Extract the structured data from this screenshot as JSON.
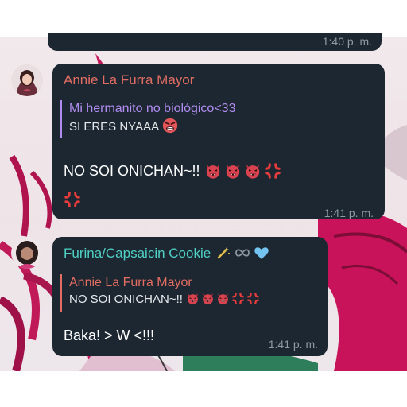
{
  "messages": [
    {
      "time": "1:40 p. m."
    },
    {
      "sender": "Annie La Furra Mayor",
      "sender_color": "#e36d62",
      "reply": {
        "sender": "Mi hermanito no biológico<33",
        "sender_color": "#b18cf0",
        "text": "SI ERES NYAAA"
      },
      "text": "NO SOI ONICHAN~!!",
      "time": "1:41 p. m."
    },
    {
      "sender": "Furina/Capsaicin Cookie",
      "sender_color": "#4fd1c5",
      "reply": {
        "sender": "Annie La Furra Mayor",
        "sender_color": "#e36d62",
        "text": "NO SOI ONICHAN~!!"
      },
      "text": "Baka! > W <!!!",
      "time": "1:41 p. m."
    }
  ],
  "icons": {
    "reply_emoji": "angry-face-emoji",
    "message_emojis": [
      "ogre-devil-emoji",
      "ogre-devil-emoji",
      "ogre-devil-emoji",
      "anger-symbol-emoji",
      "anger-symbol-emoji"
    ],
    "sender_badges": [
      "magic-wand-icon",
      "infinity-icon",
      "blue-heart-icon"
    ]
  },
  "colors": {
    "bubble": "#1c2731",
    "timestamp": "#8f9aa5"
  }
}
